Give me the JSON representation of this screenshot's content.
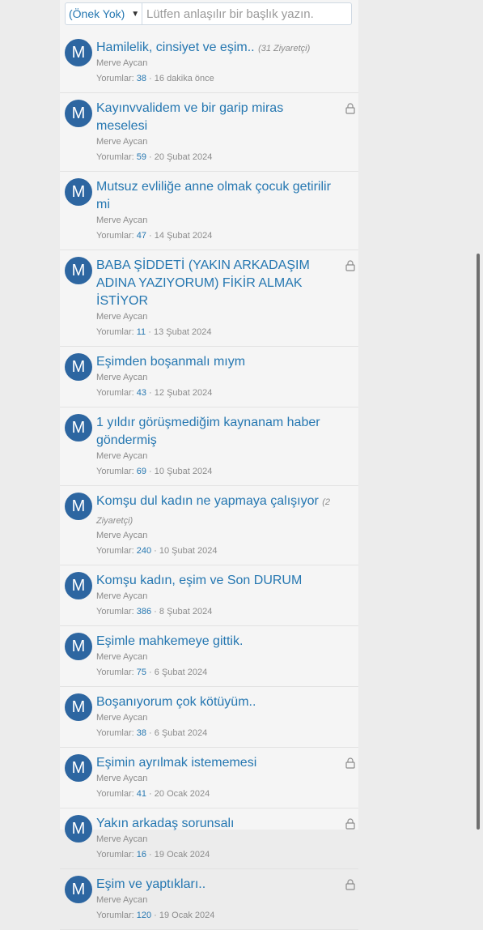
{
  "prefix": {
    "selected": "(Önek Yok)"
  },
  "title_input": {
    "placeholder": "Lütfen anlaşılır bir başlık yazın."
  },
  "stats_label": "Yorumlar:",
  "threads": [
    {
      "title": "Hamilelik, cinsiyet ve eşim..",
      "visitors": "(31 Ziyaretçi)",
      "author": "Merve Aycan",
      "comments": "38",
      "date": "16 dakika önce",
      "locked": false
    },
    {
      "title": "Kayınvvalidem ve bir garip miras meselesi",
      "visitors": "",
      "author": "Merve Aycan",
      "comments": "59",
      "date": "20 Şubat 2024",
      "locked": true
    },
    {
      "title": "Mutsuz evliliğe anne olmak çocuk getirilir mi",
      "visitors": "",
      "author": "Merve Aycan",
      "comments": "47",
      "date": "14 Şubat 2024",
      "locked": false
    },
    {
      "title": "BABA ŞİDDETİ (YAKIN ARKADAŞIM ADINA YAZIYORUM) FİKİR ALMAK İSTİYOR",
      "visitors": "",
      "author": "Merve Aycan",
      "comments": "11",
      "date": "13 Şubat 2024",
      "locked": true
    },
    {
      "title": "Eşimden boşanmalı mıym",
      "visitors": "",
      "author": "Merve Aycan",
      "comments": "43",
      "date": "12 Şubat 2024",
      "locked": false
    },
    {
      "title": "1 yıldır görüşmediğim kaynanam haber göndermiş",
      "visitors": "",
      "author": "Merve Aycan",
      "comments": "69",
      "date": "10 Şubat 2024",
      "locked": false
    },
    {
      "title": "Komşu dul kadın ne yapmaya çalışıyor",
      "visitors": "(2 Ziyaretçi)",
      "author": "Merve Aycan",
      "comments": "240",
      "date": "10 Şubat 2024",
      "locked": false
    },
    {
      "title": "Komşu kadın, eşim ve Son DURUM",
      "visitors": "",
      "author": "Merve Aycan",
      "comments": "386",
      "date": "8 Şubat 2024",
      "locked": false
    },
    {
      "title": "Eşimle mahkemeye gittik.",
      "visitors": "",
      "author": "Merve Aycan",
      "comments": "75",
      "date": "6 Şubat 2024",
      "locked": false
    },
    {
      "title": "Boşanıyorum çok kötüyüm..",
      "visitors": "",
      "author": "Merve Aycan",
      "comments": "38",
      "date": "6 Şubat 2024",
      "locked": false
    },
    {
      "title": "Eşimin ayrılmak istememesi",
      "visitors": "",
      "author": "Merve Aycan",
      "comments": "41",
      "date": "20 Ocak 2024",
      "locked": true
    },
    {
      "title": "Yakın arkadaş sorunsalı",
      "visitors": "",
      "author": "Merve Aycan",
      "comments": "16",
      "date": "19 Ocak 2024",
      "locked": true
    },
    {
      "title": "Eşim ve yaptıkları..",
      "visitors": "",
      "author": "Merve Aycan",
      "comments": "120",
      "date": "19 Ocak 2024",
      "locked": true
    }
  ],
  "avatar_letter": "M",
  "colors": {
    "link": "#2577b1",
    "avatar": "#2d66a1",
    "muted": "#8c8c8c"
  },
  "icons": {
    "lock": "lock-icon",
    "caret": "caret-down-icon"
  }
}
